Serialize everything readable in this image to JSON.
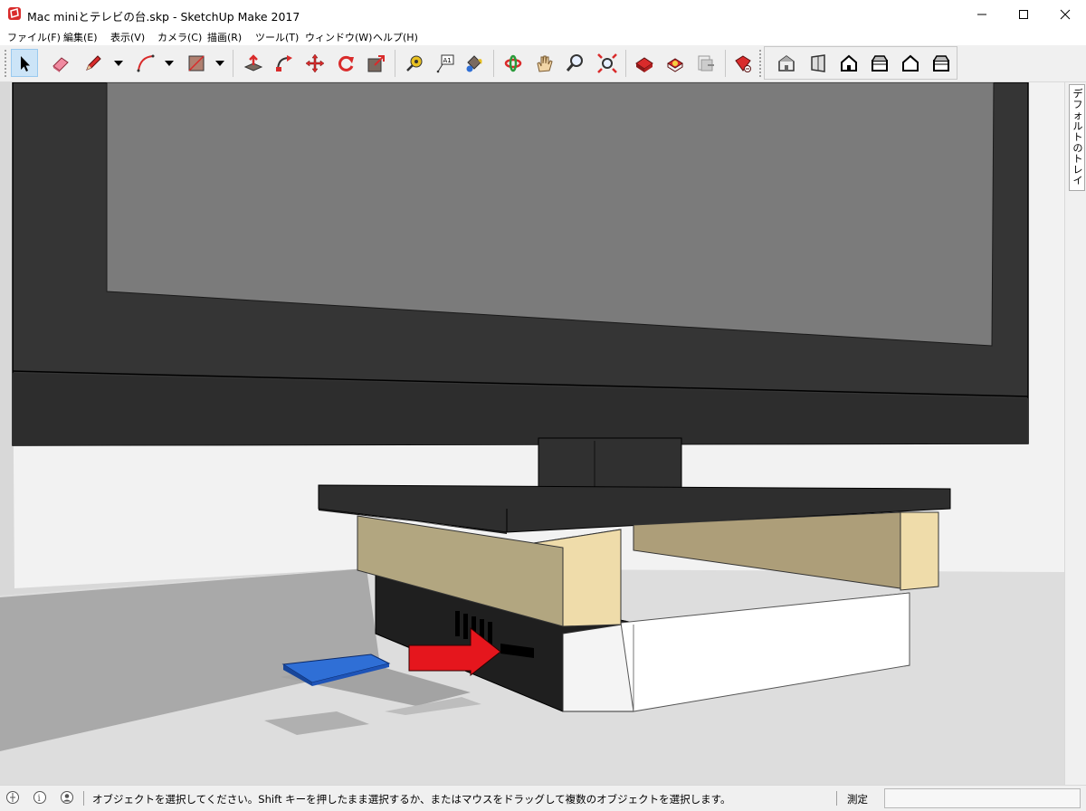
{
  "window": {
    "title": "Mac miniとテレビの台.skp - SketchUp Make 2017"
  },
  "menu": [
    {
      "label": "ファイル(F)"
    },
    {
      "label": "編集(E)"
    },
    {
      "label": "表示(V)"
    },
    {
      "label": "カメラ(C)"
    },
    {
      "label": "描画(R)"
    },
    {
      "label": "ツール(T)"
    },
    {
      "label": "ウィンドウ(W)"
    },
    {
      "label": "ヘルプ(H)"
    }
  ],
  "toolbar": {
    "active_tool": "select",
    "tools": [
      "select-icon",
      "eraser-icon",
      "pencil-icon",
      "arc-icon",
      "rectangle-icon",
      "push-pull-icon",
      "follow-me-icon",
      "move-icon",
      "rotate-icon",
      "scale-icon",
      "tape-measure-icon",
      "text-icon",
      "paint-bucket-icon",
      "orbit-icon",
      "pan-icon",
      "zoom-icon",
      "zoom-extents-icon",
      "3d-warehouse-icon",
      "extension-warehouse-icon",
      "send-to-layout-icon",
      "extension-manager-icon",
      "iso-view-icon",
      "right-view-icon",
      "front-view-icon",
      "top-view-icon",
      "left-view-icon",
      "back-view-icon"
    ]
  },
  "tray": {
    "label": "デフォルトのトレイ"
  },
  "status": {
    "message": "オブジェクトを選択してください。Shift キーを押したまま選択するか、またはマウスをドラッグして複数のオブジェクトを選択します。",
    "measure_label": "測定",
    "measure_value": ""
  },
  "colors": {
    "accent": "#0078d7",
    "sketchup_red": "#d92b2b",
    "arrow": "#e5161d",
    "card": "#2f6fd6"
  }
}
